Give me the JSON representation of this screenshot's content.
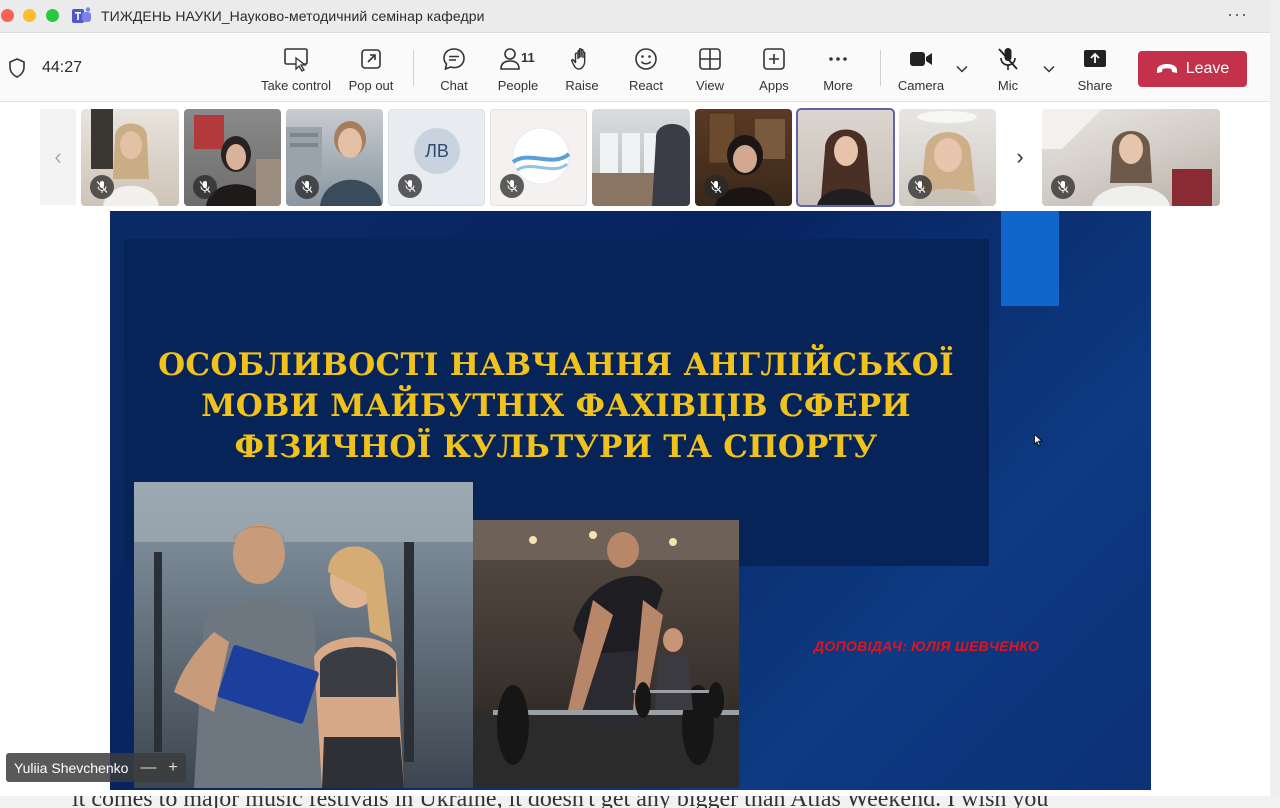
{
  "window": {
    "title": "ТИЖДЕНЬ НАУКИ_Науково-методичний семінар кафедри",
    "more_glyph": "···"
  },
  "toolbar": {
    "timer": "44:27",
    "take_control": "Take control",
    "pop_out": "Pop out",
    "chat": "Chat",
    "people": "People",
    "people_count": "11",
    "raise": "Raise",
    "react": "React",
    "view": "View",
    "apps": "Apps",
    "more": "More",
    "camera": "Camera",
    "mic": "Mic",
    "share": "Share",
    "leave": "Leave"
  },
  "strip": {
    "avatar_initials": "ЛВ"
  },
  "slide": {
    "title_line1": "ОСОБЛИВОСТІ НАВЧАННЯ АНГЛІЙСЬКОЇ",
    "title_line2": "МОВИ  МАЙБУТНІХ ФАХІВЦІВ СФЕРИ",
    "title_line3": "ФІЗИЧНОЇ КУЛЬТУРИ ТА СПОРТУ",
    "presenter": "ДОПОВІДАЧ: ЮЛІЯ ШЕВЧЕНКО"
  },
  "name_tag": {
    "name": "Yuliia Shevchenko",
    "minus": "—",
    "plus": "+"
  },
  "behind_window": {
    "text": "it comes to major music festivals in Ukraine, it doesn't get any bigger than Atlas Weekend. I wish you"
  },
  "colors": {
    "leave": "#c4314b",
    "active_tile": "#6264a7",
    "slide_bg": "#0c2d6b",
    "slide_title": "#f1c21b",
    "presenter_text": "#e0141e"
  }
}
